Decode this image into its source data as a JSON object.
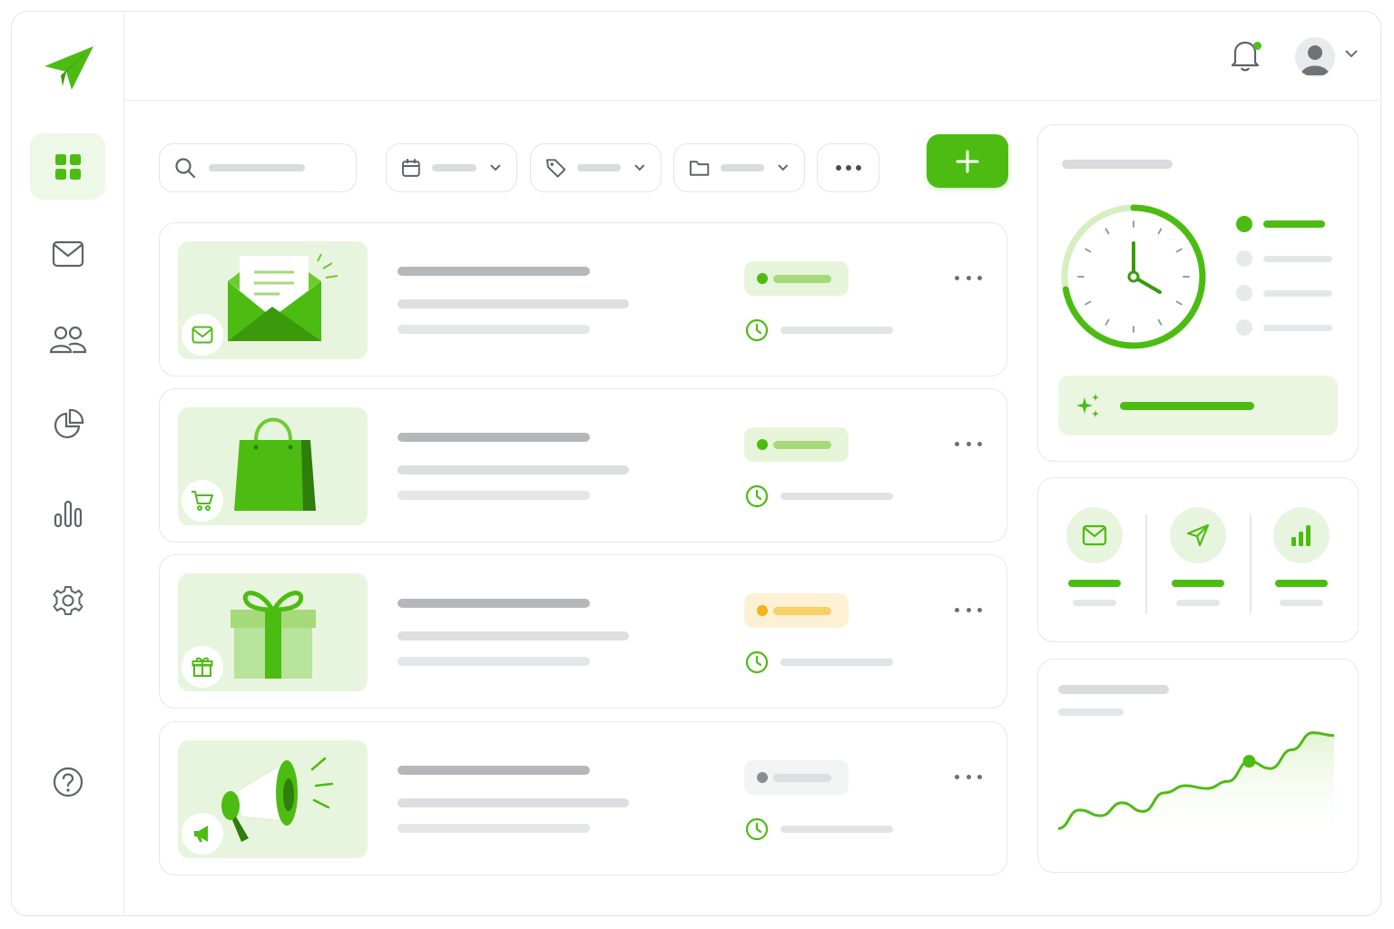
{
  "app": {
    "accent": "#4cbc12",
    "accent_light": "#e8f5de"
  },
  "sidebar": {
    "logo": "paper-plane-logo",
    "items": [
      {
        "icon": "dashboard-grid-icon",
        "active": true
      },
      {
        "icon": "mail-icon",
        "active": false
      },
      {
        "icon": "users-icon",
        "active": false
      },
      {
        "icon": "pie-chart-icon",
        "active": false
      },
      {
        "icon": "bar-chart-icon",
        "active": false
      },
      {
        "icon": "settings-gear-icon",
        "active": false
      }
    ],
    "help_icon": "help-circle-icon"
  },
  "topbar": {
    "notifications_icon": "bell-icon",
    "has_unread": true,
    "avatar_icon": "user-avatar-icon"
  },
  "toolbar": {
    "filters": [
      "search",
      "date",
      "tag",
      "folder",
      "more"
    ],
    "add_button_icon": "plus-icon"
  },
  "campaigns": [
    {
      "type": "email",
      "image": "open-envelope-illustration",
      "badge_icon": "mail-icon",
      "status": "active",
      "status_color": "#4cbc12"
    },
    {
      "type": "shop",
      "image": "shopping-bag-illustration",
      "badge_icon": "cart-icon",
      "status": "active",
      "status_color": "#4cbc12"
    },
    {
      "type": "gift",
      "image": "gift-box-illustration",
      "badge_icon": "gift-icon",
      "status": "pending",
      "status_color": "#f2b21a"
    },
    {
      "type": "promo",
      "image": "megaphone-illustration",
      "badge_icon": "megaphone-icon",
      "status": "inactive",
      "status_color": "#8a8d90"
    }
  ],
  "schedule_panel": {
    "clock_progress": 0.72,
    "legend": [
      {
        "active": true
      },
      {
        "active": false
      },
      {
        "active": false
      },
      {
        "active": false
      }
    ],
    "cta_icon": "sparkle-icon"
  },
  "stats": [
    {
      "icon": "mail-icon"
    },
    {
      "icon": "send-icon"
    },
    {
      "icon": "bar-chart-icon"
    }
  ],
  "trend_chart": {
    "y": [
      15,
      28,
      24,
      33,
      27,
      40,
      45,
      43,
      48,
      62,
      57,
      70,
      82,
      80
    ]
  }
}
